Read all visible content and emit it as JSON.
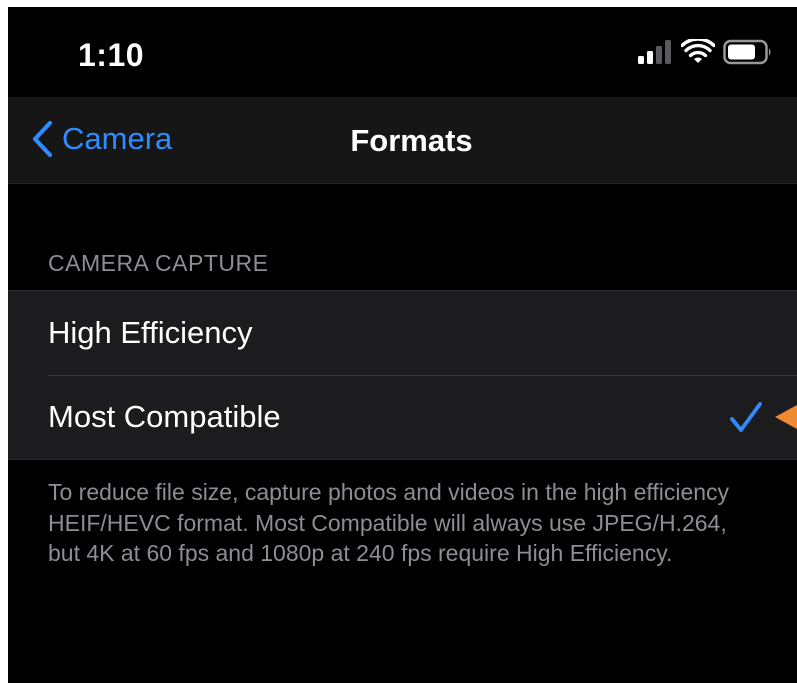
{
  "status_bar": {
    "time": "1:10",
    "signal_bars_filled": 2,
    "signal_bars_total": 4,
    "icons": [
      "cellular-signal-icon",
      "wifi-icon",
      "battery-icon"
    ]
  },
  "nav": {
    "back_label": "Camera",
    "back_icon": "chevron-left-icon",
    "title": "Formats"
  },
  "section": {
    "header": "CAMERA CAPTURE",
    "options": [
      {
        "label": "High Efficiency",
        "selected": false
      },
      {
        "label": "Most Compatible",
        "selected": true
      }
    ],
    "footer": "To reduce file size, capture photos and videos in the high efficiency HEIF/HEVC format. Most Compatible will always use JPEG/H.264, but 4K at 60 fps and 1080p at 240 fps require High Efficiency."
  },
  "colors": {
    "background": "#000000",
    "accent": "#2f8cff",
    "secondary_text": "#8d8d93",
    "group_background": "#1c1c1e",
    "annotation": "#f08a30"
  }
}
